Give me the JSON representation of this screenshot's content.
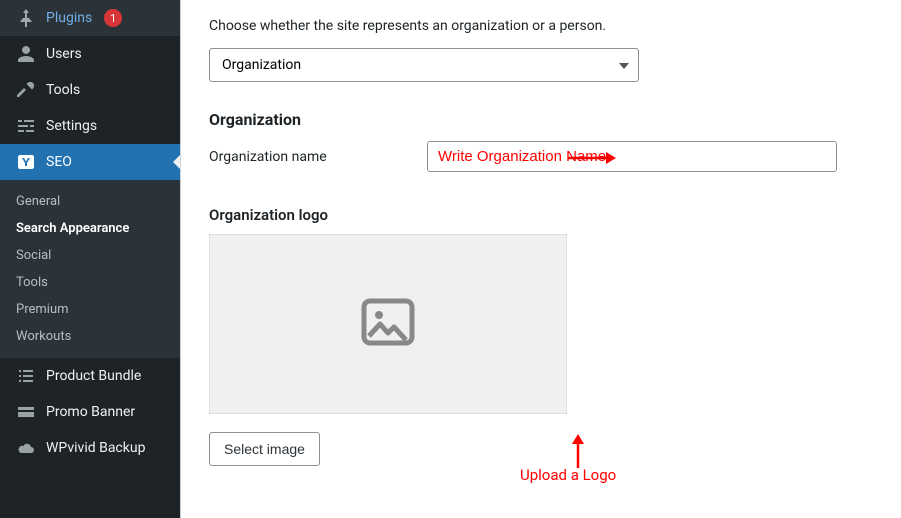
{
  "sidebar": {
    "items": [
      {
        "label": "Plugins",
        "badge": "1"
      },
      {
        "label": "Users"
      },
      {
        "label": "Tools"
      },
      {
        "label": "Settings"
      },
      {
        "label": "SEO"
      },
      {
        "label": "Product Bundle"
      },
      {
        "label": "Promo Banner"
      },
      {
        "label": "WPvivid Backup"
      }
    ],
    "seo_submenu": [
      {
        "label": "General"
      },
      {
        "label": "Search Appearance"
      },
      {
        "label": "Social"
      },
      {
        "label": "Tools"
      },
      {
        "label": "Premium"
      },
      {
        "label": "Workouts"
      }
    ]
  },
  "content": {
    "description": "Choose whether the site represents an organization or a person.",
    "entity_select": "Organization",
    "org_heading": "Organization",
    "org_name_label": "Organization name",
    "org_name_value": "Write Organization Name",
    "org_logo_label": "Organization logo",
    "select_image_btn": "Select image"
  },
  "annotations": {
    "upload_logo": "Upload a Logo"
  }
}
